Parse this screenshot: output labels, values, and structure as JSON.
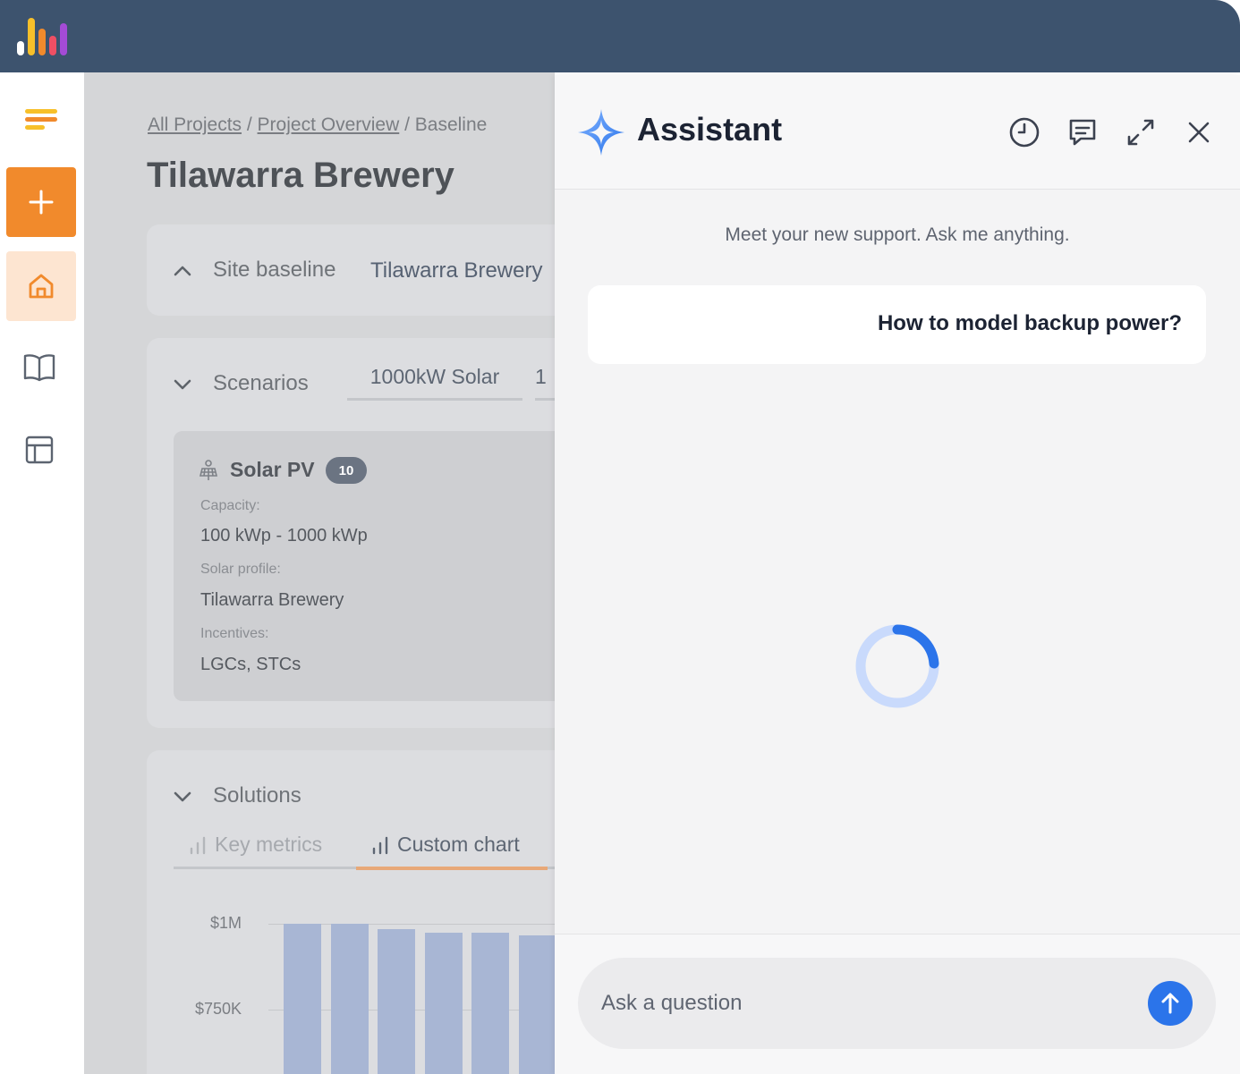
{
  "breadcrumb": {
    "items": [
      "All Projects",
      "Project Overview",
      "Baseline"
    ],
    "separator": " / "
  },
  "page": {
    "title": "Tilawarra Brewery"
  },
  "site_baseline": {
    "label": "Site baseline",
    "value": "Tilawarra Brewery"
  },
  "scenarios": {
    "label": "Scenarios",
    "tabs": [
      "1000kW Solar",
      "1"
    ]
  },
  "solar_pv": {
    "title": "Solar PV",
    "badge": "10",
    "fields": [
      {
        "label": "Capacity:",
        "value": "100 kWp - 1000 kWp"
      },
      {
        "label": "Solar profile:",
        "value": "Tilawarra Brewery"
      },
      {
        "label": "Incentives:",
        "value": "LGCs, STCs"
      }
    ]
  },
  "solutions": {
    "label": "Solutions",
    "tabs": [
      "Key metrics",
      "Custom chart"
    ],
    "active_tab": "Custom chart"
  },
  "chart_data": {
    "type": "bar",
    "title": "",
    "xlabel": "",
    "ylabel": "",
    "ytick_labels": [
      "$1M",
      "$750K"
    ],
    "ylim": [
      0,
      1000000
    ],
    "values": [
      1000000,
      1000000,
      985000,
      975000,
      975000,
      965000
    ],
    "color": "#a8b6d4"
  },
  "assistant": {
    "title": "Assistant",
    "welcome": "Meet your new support. Ask me anything.",
    "user_message": "How to model backup power?",
    "input_placeholder": "Ask a question",
    "header_icons": [
      "history-icon",
      "chat-icon",
      "expand-icon",
      "close-icon"
    ],
    "accent_color": "#2b74ea"
  },
  "colors": {
    "topbar": "#3d536e",
    "primary_orange": "#f18a2c",
    "home_highlight": "#fde5d1"
  }
}
